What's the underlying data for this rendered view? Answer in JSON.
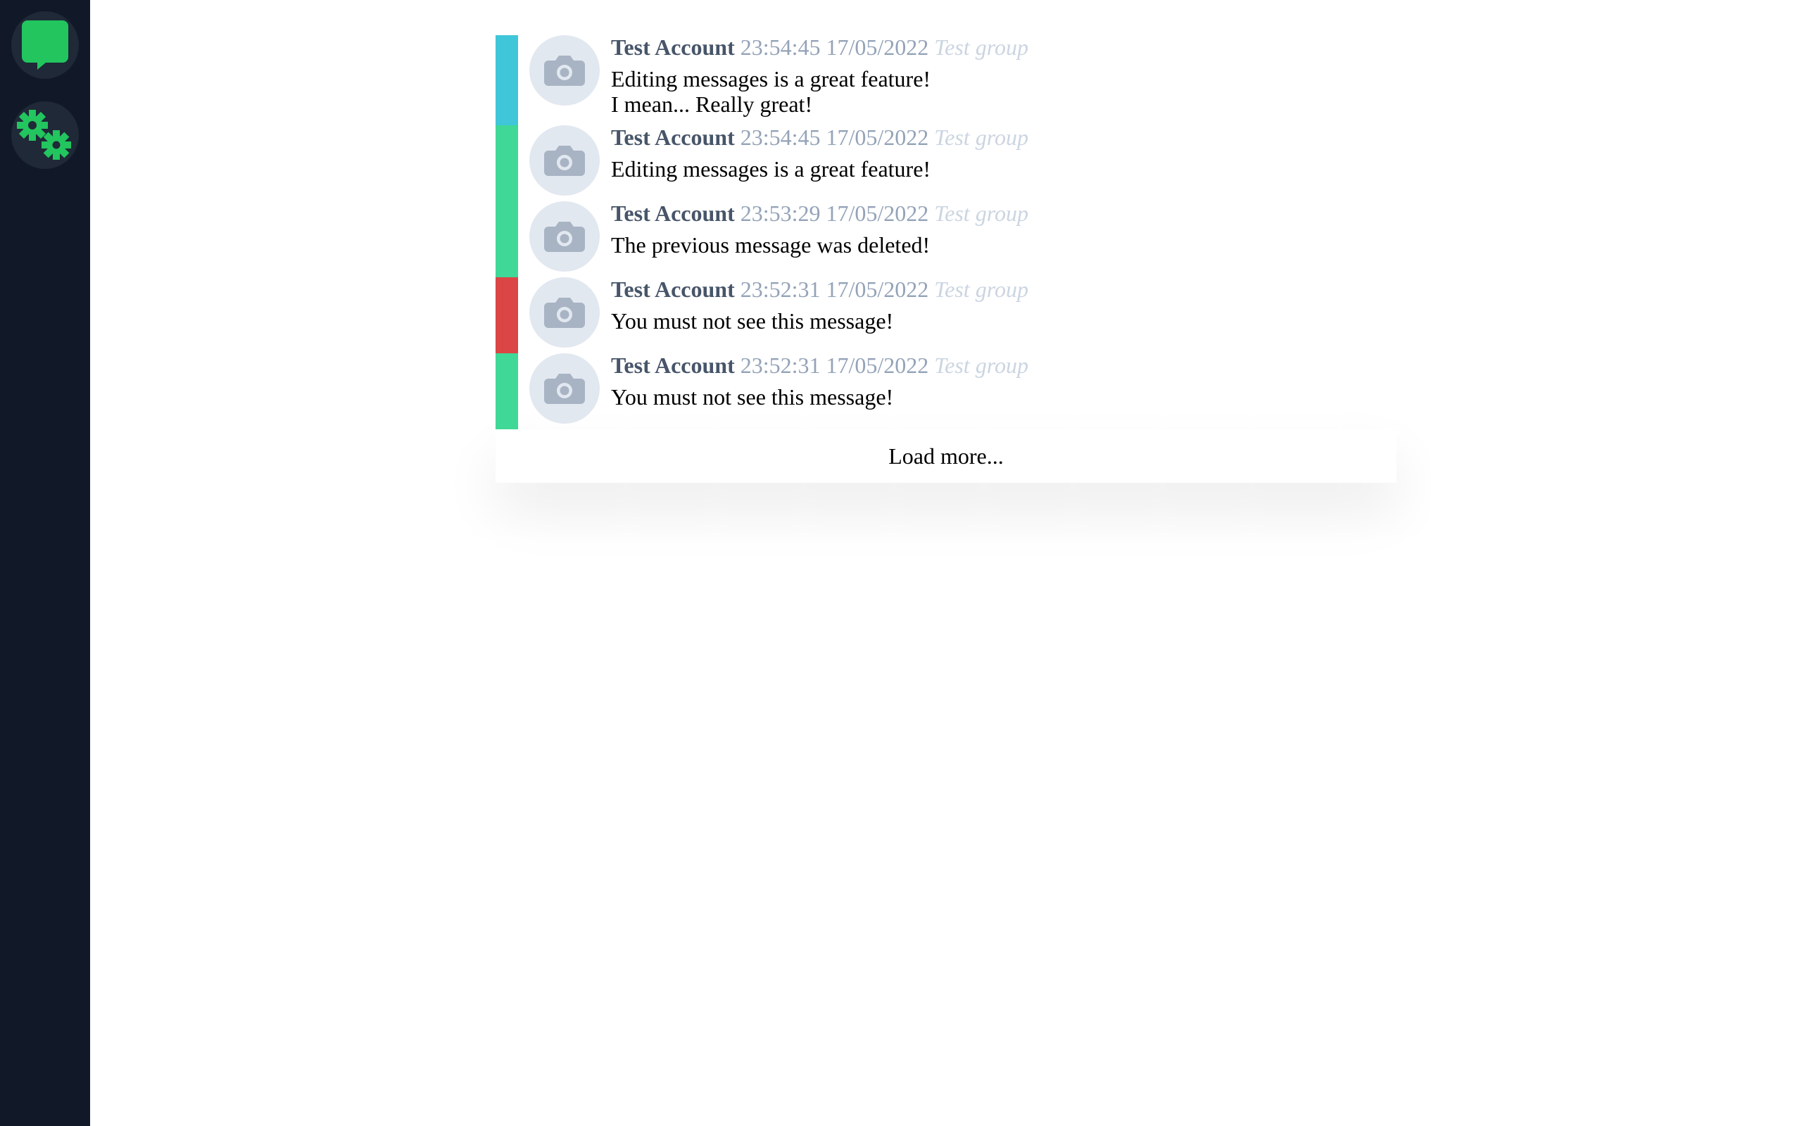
{
  "colors": {
    "sidebar_bg": "#111827",
    "nav_button_bg": "#1f2937",
    "accent_green": "#22c55e",
    "status_cyan": "#3fc6d9",
    "status_green": "#3fd896",
    "status_red": "#dc4545",
    "avatar_bg": "#e2e8f0",
    "avatar_icon": "#a8b4c4"
  },
  "sidebar": {
    "items": [
      {
        "name": "chat",
        "icon": "chat-bubble-icon"
      },
      {
        "name": "settings",
        "icon": "gears-icon"
      }
    ]
  },
  "messages": [
    {
      "status_color": "#3fc6d9",
      "author": "Test Account",
      "timestamp": "23:54:45 17/05/2022",
      "group": "Test group",
      "lines": [
        "Editing messages is a great feature!",
        "I mean... Really great!"
      ]
    },
    {
      "status_color": "#3fd896",
      "author": "Test Account",
      "timestamp": "23:54:45 17/05/2022",
      "group": "Test group",
      "lines": [
        "Editing messages is a great feature!"
      ]
    },
    {
      "status_color": "#3fd896",
      "author": "Test Account",
      "timestamp": "23:53:29 17/05/2022",
      "group": "Test group",
      "lines": [
        "The previous message was deleted!"
      ]
    },
    {
      "status_color": "#dc4545",
      "author": "Test Account",
      "timestamp": "23:52:31 17/05/2022",
      "group": "Test group",
      "lines": [
        "You must not see this message!"
      ]
    },
    {
      "status_color": "#3fd896",
      "author": "Test Account",
      "timestamp": "23:52:31 17/05/2022",
      "group": "Test group",
      "lines": [
        "You must not see this message!"
      ]
    }
  ],
  "load_more_label": "Load more..."
}
